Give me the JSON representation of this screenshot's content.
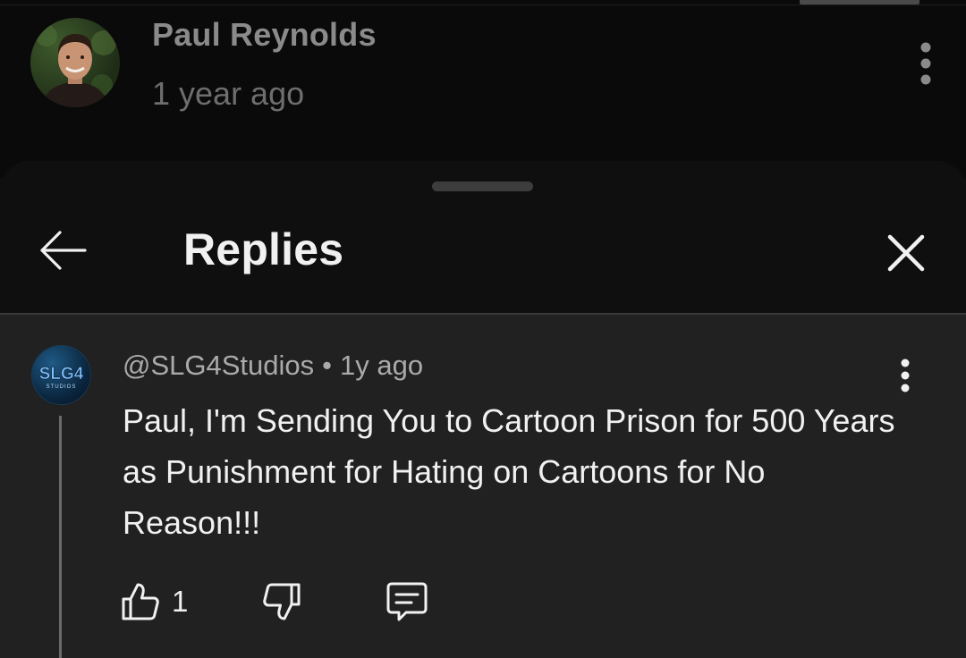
{
  "parent_comment": {
    "author": "Paul Reynolds",
    "time": "1 year ago"
  },
  "sheet": {
    "title": "Replies"
  },
  "reply": {
    "avatar_text": "SLG4",
    "avatar_subtext": "STUDIOS",
    "handle": "@SLG4Studios",
    "separator": "•",
    "time": "1y ago",
    "text": "Paul, I'm Sending You to Cartoon Prison for 500 Years as Punishment for Hating on Cartoons for No Reason!!!",
    "like_count": "1"
  },
  "colors": {
    "background": "#0f0f0f",
    "sheet": "#212121",
    "text_primary": "#f1f1f1",
    "text_secondary": "#aaaaaa"
  },
  "icons": [
    "more-vert-icon",
    "arrow-back-icon",
    "close-icon",
    "thumb-up-icon",
    "thumb-down-icon",
    "reply-comment-icon"
  ]
}
